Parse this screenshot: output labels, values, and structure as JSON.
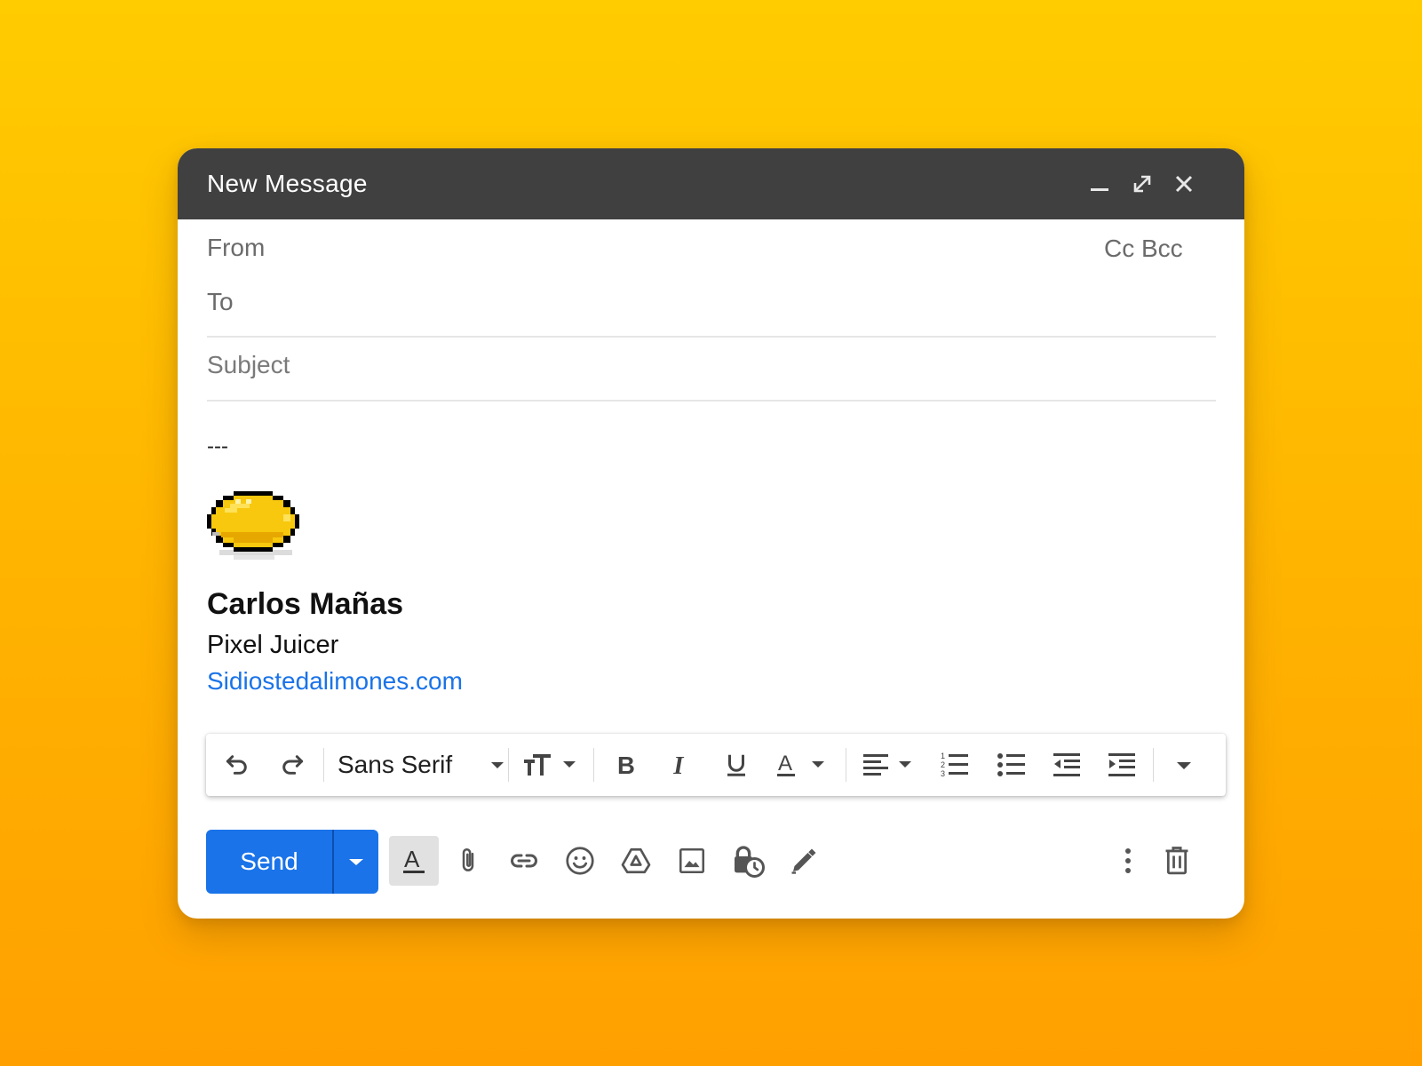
{
  "window": {
    "title": "New Message",
    "controls": {
      "minimize_icon": "minimize-icon",
      "fullscreen_icon": "expand-icon",
      "close_icon": "close-icon"
    }
  },
  "fields": {
    "from_label": "From",
    "cc_bcc_label": "Cc Bcc",
    "to_label": "To",
    "subject_placeholder": "Subject"
  },
  "body": {
    "separator": "---",
    "signature": {
      "name": "Carlos Mañas",
      "role": "Pixel Juicer",
      "link": "Sidiostedalimones.com",
      "image_icon": "pixel-lemon-icon"
    }
  },
  "format_toolbar": {
    "font": "Sans Serif",
    "icons": [
      "undo-icon",
      "redo-icon",
      "font-dropdown-icon",
      "text-size-icon",
      "bold-icon",
      "italic-icon",
      "underline-icon",
      "text-color-icon",
      "align-icon",
      "numbered-list-icon",
      "bulleted-list-icon",
      "indent-less-icon",
      "indent-more-icon",
      "more-formatting-icon"
    ]
  },
  "actions": {
    "send_label": "Send",
    "icons": [
      "formatting-options-icon",
      "attach-icon",
      "link-icon",
      "emoji-icon",
      "drive-icon",
      "photo-icon",
      "confidential-mode-icon",
      "signature-icon",
      "more-options-icon",
      "discard-icon"
    ]
  },
  "colors": {
    "background_top": "#ffcc00",
    "background_bottom": "#ffa000",
    "titlebar": "#404040",
    "send_button": "#1a73e8",
    "link": "#1a73e8"
  }
}
